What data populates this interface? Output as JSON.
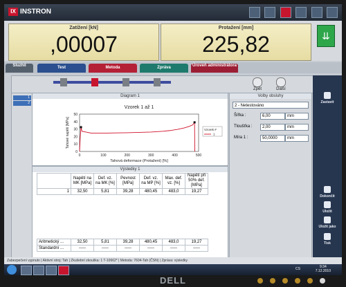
{
  "app": {
    "logo_text": "INSTRON"
  },
  "readouts": [
    {
      "label": "Zatížení [kN]",
      "value": ",00007"
    },
    {
      "label": "Protažení [mm]",
      "value": "225,82"
    }
  ],
  "tabs": [
    {
      "label": "Test"
    },
    {
      "label": "Metoda"
    },
    {
      "label": "Zpráva"
    },
    {
      "label": "Úroveň administrátora"
    }
  ],
  "sluzhil_label": "Sluzhil",
  "nav": {
    "back_label": "Zpět",
    "next_label": "Další"
  },
  "left_strip": {
    "row1": "1",
    "row2": "2"
  },
  "diagram": {
    "panel_title": "Diagram 1",
    "chart_title": "Vzorek 1 až 1",
    "xlabel": "Tahová deformace (Protažení) [%]",
    "ylabel": "Tahové napětí [MPa]",
    "legend": "Vzorek #",
    "legend_value": "1"
  },
  "chart_data": {
    "type": "line",
    "title": "Vzorek 1 až 1",
    "xlabel": "Tahová deformace (Protažení) [%]",
    "ylabel": "Tahové napětí [MPa]",
    "xlim": [
      0,
      500
    ],
    "ylim": [
      0,
      50
    ],
    "x_ticks": [
      0,
      100,
      200,
      300,
      400,
      500
    ],
    "y_ticks": [
      0,
      10,
      20,
      30,
      40,
      50
    ],
    "series": [
      {
        "x": [
          0,
          3,
          6,
          10,
          50,
          100,
          150,
          200,
          250,
          300,
          350,
          380,
          410,
          440,
          460,
          475,
          483,
          484
        ],
        "y": [
          0,
          20,
          32.5,
          27,
          24.5,
          24.5,
          24.8,
          25.1,
          25.5,
          26,
          27,
          28,
          29.5,
          31.5,
          33.5,
          35.5,
          39,
          0
        ]
      }
    ]
  },
  "results": {
    "panel_title": "Výsledky 1",
    "headers": [
      "Napětí na MK [MPa]",
      "Def. vz. na MK [%]",
      "Pevnost [MPa]",
      "Def. vz. na MP [%]",
      "Max. def. vz. [%]",
      "Napětí při 50% def. [MPa]"
    ],
    "rows": [
      {
        "label": "1",
        "cells": [
          "32,50",
          "5,81",
          "39,28",
          "480,45",
          "483,0",
          "19,27"
        ]
      }
    ],
    "stats": [
      {
        "label": "Aritmetický ...",
        "cells": [
          "32,50",
          "5,81",
          "39,28",
          "480,45",
          "483,0",
          "19,27"
        ]
      },
      {
        "label": "Standardní ...",
        "cells": [
          "-----",
          "-----",
          "-----",
          "-----",
          "-----",
          "-----"
        ]
      }
    ]
  },
  "right_panel": {
    "title": "Volby obsluhy",
    "dropdown": "2 - Netestováno",
    "fields": [
      {
        "label": "Šířka :",
        "value": "6,00",
        "unit": "mm"
      },
      {
        "label": "Tloušťka :",
        "value": "2,00",
        "unit": "mm"
      },
      {
        "label": "Míra 1 :",
        "value": "50,0000",
        "unit": "mm"
      }
    ]
  },
  "sidebar": [
    {
      "label": "Zastavit"
    },
    {
      "label": "Dokončit"
    },
    {
      "label": "Uložit"
    },
    {
      "label": "Uložit jako"
    },
    {
      "label": "Tisk"
    }
  ],
  "statusbar": "Zabezpečení vypnuto | Aktivní stroj: Tah | Zkušební zkouška: 1 T-10662* | Metoda: 7604-Tah (ČSN) | Zpráva: výsledky",
  "clock": {
    "time": "9:34",
    "date": "7.12.2010"
  },
  "lang": "CS",
  "bezel_brand": "DELL",
  "colors": {
    "accent_red": "#c8152e",
    "sidebar_navy": "#27364f",
    "readout_yellow": "#efe7b6",
    "tab_test": "#2b4f8f",
    "tab_metoda": "#b42036",
    "tab_zprava": "#1e7a6c",
    "tab_admin": "#9b1e34"
  }
}
